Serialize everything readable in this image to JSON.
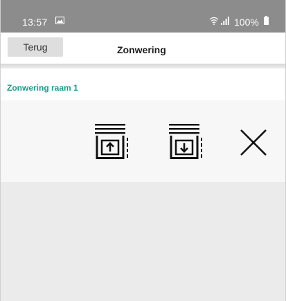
{
  "status_bar": {
    "time": "13:57",
    "battery": "100%",
    "icons": [
      "gallery-icon",
      "wifi-icon",
      "signal-icon",
      "battery-icon"
    ]
  },
  "header": {
    "back_label": "Terug",
    "title": "Zonwering"
  },
  "section": {
    "label": "Zonwering raam 1"
  },
  "controls": [
    {
      "name": "blind-up",
      "icon": "blind-up-icon"
    },
    {
      "name": "blind-down",
      "icon": "blind-down-icon"
    },
    {
      "name": "blind-stop",
      "icon": "close-icon"
    }
  ],
  "colors": {
    "status_bar": "#8c8c8c",
    "accent": "#1a9a8a",
    "button_bg": "#dedede",
    "panel_bg": "#f7f7f7",
    "page_bg": "#ebebeb"
  }
}
